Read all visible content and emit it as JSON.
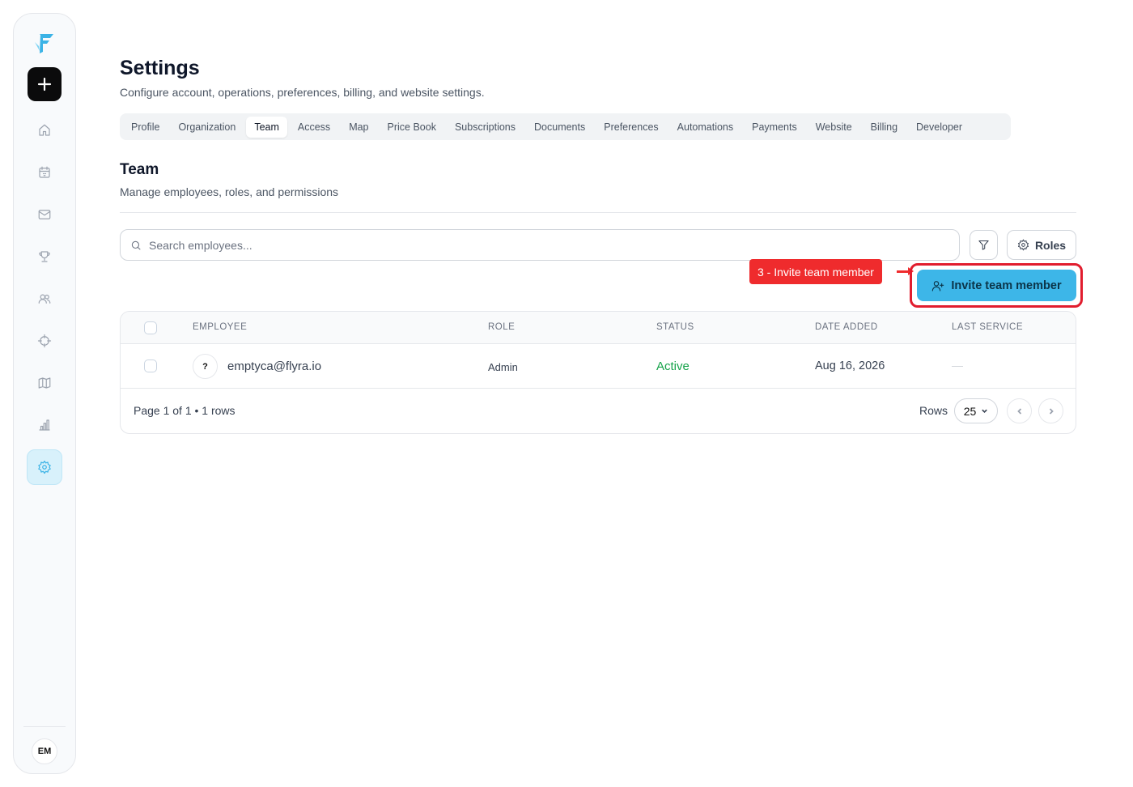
{
  "sidebar": {
    "logo_icon": "flyra-logo",
    "new_icon": "plus-icon",
    "items": [
      {
        "id": "home",
        "icon": "home-icon"
      },
      {
        "id": "calendar",
        "icon": "calendar-icon"
      },
      {
        "id": "inbox",
        "icon": "mail-icon"
      },
      {
        "id": "goals",
        "icon": "trophy-icon"
      },
      {
        "id": "customers",
        "icon": "users-icon"
      },
      {
        "id": "dispatch",
        "icon": "crosshair-icon"
      },
      {
        "id": "map",
        "icon": "map-icon"
      },
      {
        "id": "reports",
        "icon": "bar-chart-icon"
      },
      {
        "id": "settings",
        "icon": "gear-icon",
        "active": true
      }
    ],
    "user_initials": "EM",
    "accent_color": "#3bb3e6"
  },
  "header": {
    "title": "Settings",
    "subtitle": "Configure account, operations, preferences, billing, and website settings."
  },
  "tabs": [
    {
      "label": "Profile"
    },
    {
      "label": "Organization"
    },
    {
      "label": "Team",
      "active": true
    },
    {
      "label": "Access"
    },
    {
      "label": "Map"
    },
    {
      "label": "Price Book"
    },
    {
      "label": "Subscriptions"
    },
    {
      "label": "Documents"
    },
    {
      "label": "Preferences"
    },
    {
      "label": "Automations"
    },
    {
      "label": "Payments"
    },
    {
      "label": "Website"
    },
    {
      "label": "Billing"
    },
    {
      "label": "Developer"
    }
  ],
  "team": {
    "title": "Team",
    "subtitle": "Manage employees, roles, and permissions",
    "search_placeholder": "Search employees...",
    "roles_label": "Roles",
    "invite_label": "Invite team member",
    "callout": "3 - Invite team member"
  },
  "table": {
    "headers": [
      "EMPLOYEE",
      "ROLE",
      "STATUS",
      "DATE ADDED",
      "LAST SERVICE"
    ],
    "rows": [
      {
        "avatar": "?",
        "employee": "emptyca@flyra.io",
        "role": "Admin",
        "status": "Active",
        "date_added": "Aug 16, 2026",
        "last_service": "—"
      }
    ],
    "footer": {
      "page_info": "Page 1 of 1 • 1 rows",
      "rows_label": "Rows",
      "rows_value": "25"
    }
  },
  "colors": {
    "invite_button": "#3db6e8",
    "callout": "#ef2b2d",
    "status_active": "#16a34a"
  }
}
